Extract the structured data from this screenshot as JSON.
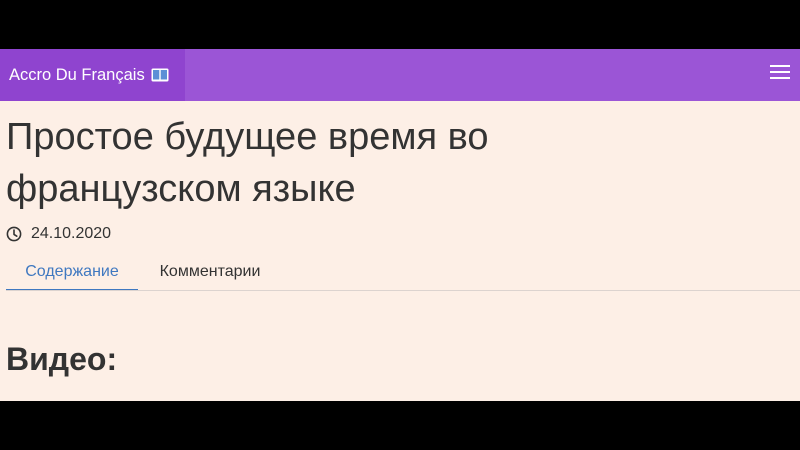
{
  "navbar": {
    "brand_label": "Accro Du Français",
    "brand_icon": "book-icon",
    "menu_icon": "hamburger-menu-icon"
  },
  "article": {
    "title_line1": "Простое будущее время во",
    "title_line2": "французском языке",
    "date_icon": "clock-icon",
    "date": "24.10.2020"
  },
  "tabs": [
    {
      "label": "Содержание",
      "active": true
    },
    {
      "label": "Комментарии",
      "active": false
    }
  ],
  "content": {
    "section_heading": "Видео:"
  },
  "colors": {
    "navbar_bg": "#9b55d6",
    "brand_bg": "#8f44cf",
    "page_bg": "#fdefe6",
    "active_tab": "#3f78c0",
    "text": "#333333"
  }
}
